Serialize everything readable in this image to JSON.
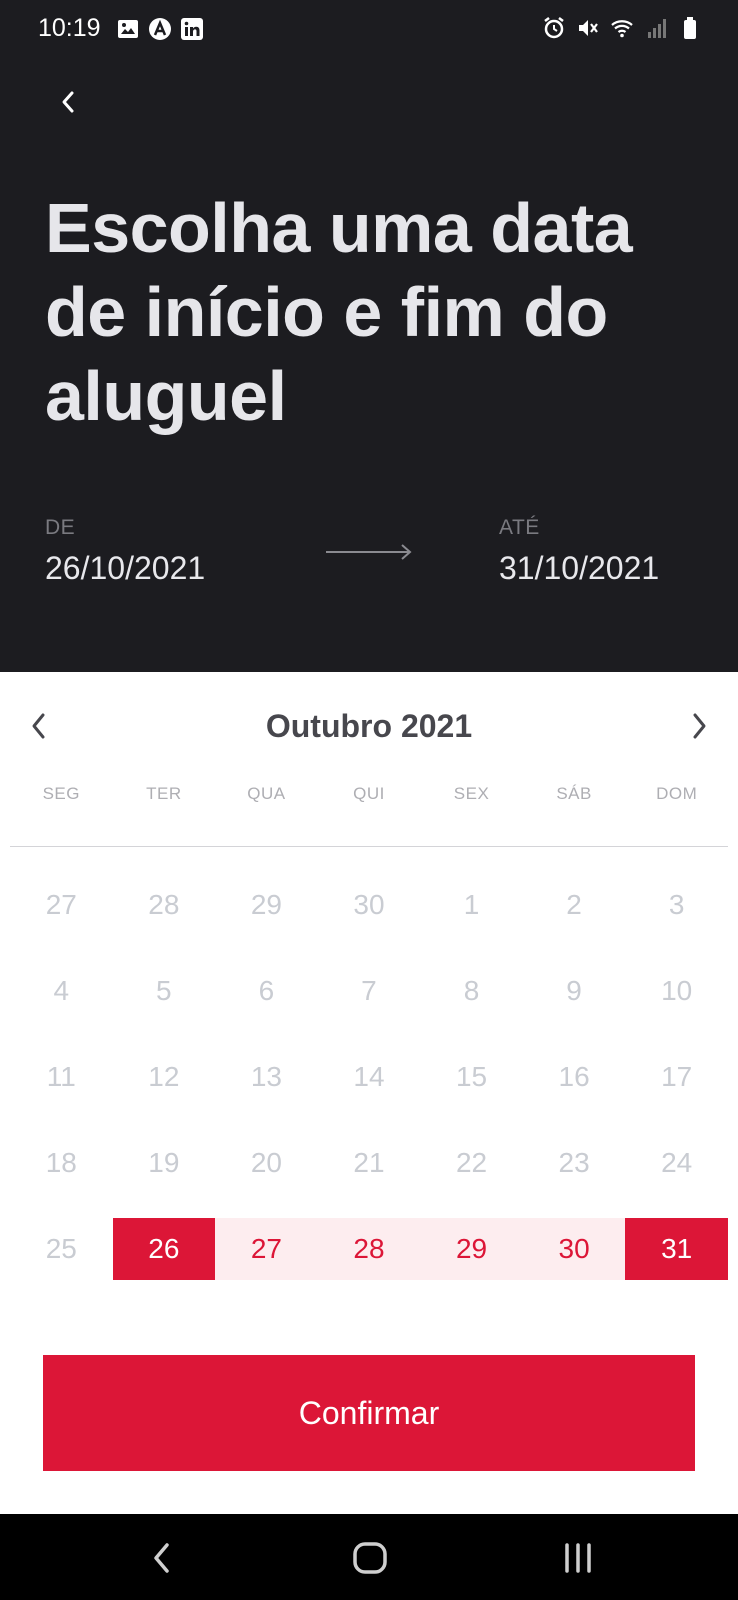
{
  "status_bar": {
    "time": "10:19",
    "left_icons": [
      "image-icon",
      "a-icon",
      "linkedin-icon"
    ],
    "right_icons": [
      "alarm-icon",
      "mute-icon",
      "wifi-icon",
      "signal-icon",
      "battery-icon"
    ]
  },
  "header": {
    "back_icon": "chevron-left-icon",
    "title": "Escolha uma data de início e fim do aluguel",
    "from_label": "DE",
    "from_value": "26/10/2021",
    "to_label": "ATÉ",
    "to_value": "31/10/2021"
  },
  "calendar": {
    "month_label": "Outubro 2021",
    "prev_icon": "chevron-left-icon",
    "next_icon": "chevron-right-icon",
    "weekdays": [
      "SEG",
      "TER",
      "QUA",
      "QUI",
      "SEX",
      "SÁB",
      "DOM"
    ],
    "weeks": [
      [
        "27",
        "28",
        "29",
        "30",
        "1",
        "2",
        "3"
      ],
      [
        "4",
        "5",
        "6",
        "7",
        "8",
        "9",
        "10"
      ],
      [
        "11",
        "12",
        "13",
        "14",
        "15",
        "16",
        "17"
      ],
      [
        "18",
        "19",
        "20",
        "21",
        "22",
        "23",
        "24"
      ],
      [
        "25",
        "26",
        "27",
        "28",
        "29",
        "30",
        "31"
      ]
    ],
    "range_start": "26",
    "range_end": "31"
  },
  "confirm_label": "Confirmar",
  "colors": {
    "accent": "#dc1637",
    "range_fill": "#fdedef",
    "header_bg": "#1c1c20"
  }
}
